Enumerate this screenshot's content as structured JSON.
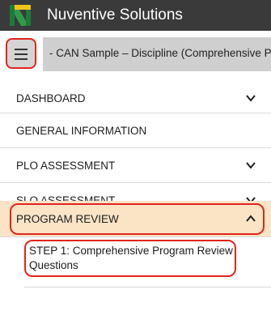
{
  "app": {
    "title": "Nuventive Solutions"
  },
  "header": {
    "breadcrumb": "- CAN Sample – Discipline (Comprehensive PR)"
  },
  "nav": {
    "items": [
      {
        "label": "DASHBOARD",
        "has_chevron": true,
        "chevron": "chevron-down-icon"
      },
      {
        "label": "GENERAL INFORMATION",
        "has_chevron": false
      },
      {
        "label": "PLO ASSESSMENT",
        "has_chevron": true,
        "chevron": "chevron-down-icon"
      },
      {
        "label": "SLO ASSESSMENT",
        "has_chevron": true,
        "chevron": "chevron-down-icon"
      },
      {
        "label": "PROGRAM REVIEW",
        "has_chevron": true,
        "chevron": "chevron-up-icon",
        "expanded": true
      }
    ],
    "sub_items": [
      {
        "label": "STEP 1: Comprehensive Program Review Questions"
      }
    ]
  },
  "colors": {
    "topbar": "#3a3a3a",
    "highlight": "#e0251b",
    "active_bg": "#fbe3c6",
    "logo_green": "#1f7a3a",
    "logo_yellow": "#f2c417"
  }
}
